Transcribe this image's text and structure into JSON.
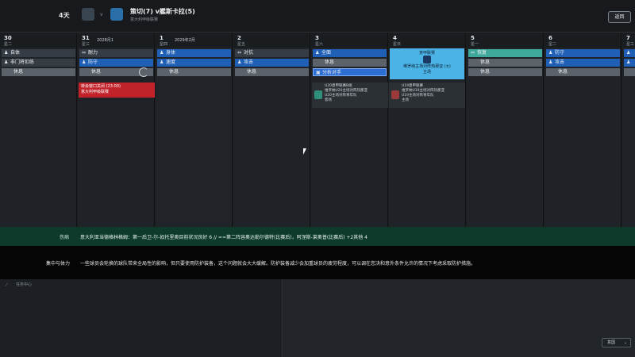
{
  "header": {
    "days": "4天",
    "vs": "v",
    "match_title": "策切(7) v艦斯卡拉(5)",
    "match_sub": "意大利甲级联赛",
    "return_label": "返回"
  },
  "calendar": {
    "columns": [
      {
        "num": "30",
        "week": "星二",
        "month": "",
        "slots": [
          {
            "label": "自体",
            "icon": "♟",
            "style": "dark"
          },
          {
            "label": "非门将扣练",
            "icon": "♟",
            "style": "dark"
          },
          {
            "label": "休息",
            "icon": "",
            "style": "gray"
          }
        ]
      },
      {
        "num": "31",
        "week": "星三",
        "month": "2028月1",
        "slots": [
          {
            "label": "耐力",
            "icon": "⇔",
            "style": "dark"
          },
          {
            "label": "防守",
            "icon": "♟",
            "style": "blue"
          },
          {
            "label": "休息",
            "icon": "",
            "style": "gray"
          }
        ]
      },
      {
        "num": "1",
        "week": "星四",
        "month": "2029年2月",
        "slots": [
          {
            "label": "身体",
            "icon": "♟",
            "style": "blue"
          },
          {
            "label": "速度",
            "icon": "♟",
            "style": "blue"
          },
          {
            "label": "休息",
            "icon": "",
            "style": "gray"
          }
        ]
      },
      {
        "num": "2",
        "week": "星五",
        "month": "",
        "slots": [
          {
            "label": "对抗",
            "icon": "⇔",
            "style": "dark"
          },
          {
            "label": "攻击",
            "icon": "♟",
            "style": "blue"
          },
          {
            "label": "休息",
            "icon": "",
            "style": "gray"
          }
        ]
      },
      {
        "num": "3",
        "week": "星六",
        "month": "",
        "slots": [
          {
            "label": "全面",
            "icon": "♟",
            "style": "blue"
          },
          {
            "label": "休息",
            "icon": "",
            "style": "gray"
          },
          {
            "label": "分析对手",
            "icon": "▣",
            "style": "sel"
          }
        ]
      },
      {
        "num": "4",
        "week": "星日",
        "month": "",
        "slots": []
      },
      {
        "num": "5",
        "week": "星一",
        "month": "",
        "slots": [
          {
            "label": "恢复",
            "icon": "⇔",
            "style": "teal"
          },
          {
            "label": "休息",
            "icon": "",
            "style": "gray"
          },
          {
            "label": "休息",
            "icon": "",
            "style": "gray"
          }
        ]
      },
      {
        "num": "6",
        "week": "星二",
        "month": "",
        "slots": [
          {
            "label": "防守",
            "icon": "♟",
            "style": "blue"
          },
          {
            "label": "攻击",
            "icon": "♟",
            "style": "blue"
          },
          {
            "label": "休息",
            "icon": "",
            "style": "gray"
          }
        ]
      },
      {
        "num": "7",
        "week": "星三",
        "month": "",
        "slots": [
          {
            "label": "",
            "icon": "♟",
            "style": "blue"
          },
          {
            "label": "",
            "icon": "♟",
            "style": "blue"
          },
          {
            "label": "",
            "icon": "",
            "style": "gray"
          }
        ]
      }
    ],
    "red_card": {
      "line1": "转会窗口关闭 (23:00)",
      "line2": "意大利甲级联赛"
    },
    "big_event": {
      "line1": "意甲联赛",
      "line2": "维罗纳主场对阵热那亚 (±)",
      "line3": "主场"
    },
    "match_cards": [
      {
        "line1": "U20意甲联赛B组",
        "line2": "维罗纳U20主场对阵热那亚",
        "line3": "U20主场对阵青年队",
        "line4": "客场"
      },
      {
        "line1": "U19意甲联赛",
        "line2": "维罗纳U19主场对阵热那亚",
        "line3": "U19主场对阵青年队",
        "line4": "主场"
      }
    ]
  },
  "news": {
    "label": "伤病",
    "text": "意大利亚当德格林格姆：第一后卫-尔-奴托里奥目前状况良好 6 // ==第二阵容奥达勒尔德特(比赛后)，阿涅斯-莱奥普(比赛后) +2其他 4"
  },
  "strip": {
    "label": "集中与体力",
    "text": "一些球员会轮换的球队带来全局性的影响，但只要使用防护装备，这个问题就会大大缓解。防护装备减少会加重球员的疲劳程度，可以调在您决和意外条件允许的情况下考虑采取防护措施。"
  },
  "bottom": {
    "left_text": "任务中心",
    "country": "意国"
  }
}
